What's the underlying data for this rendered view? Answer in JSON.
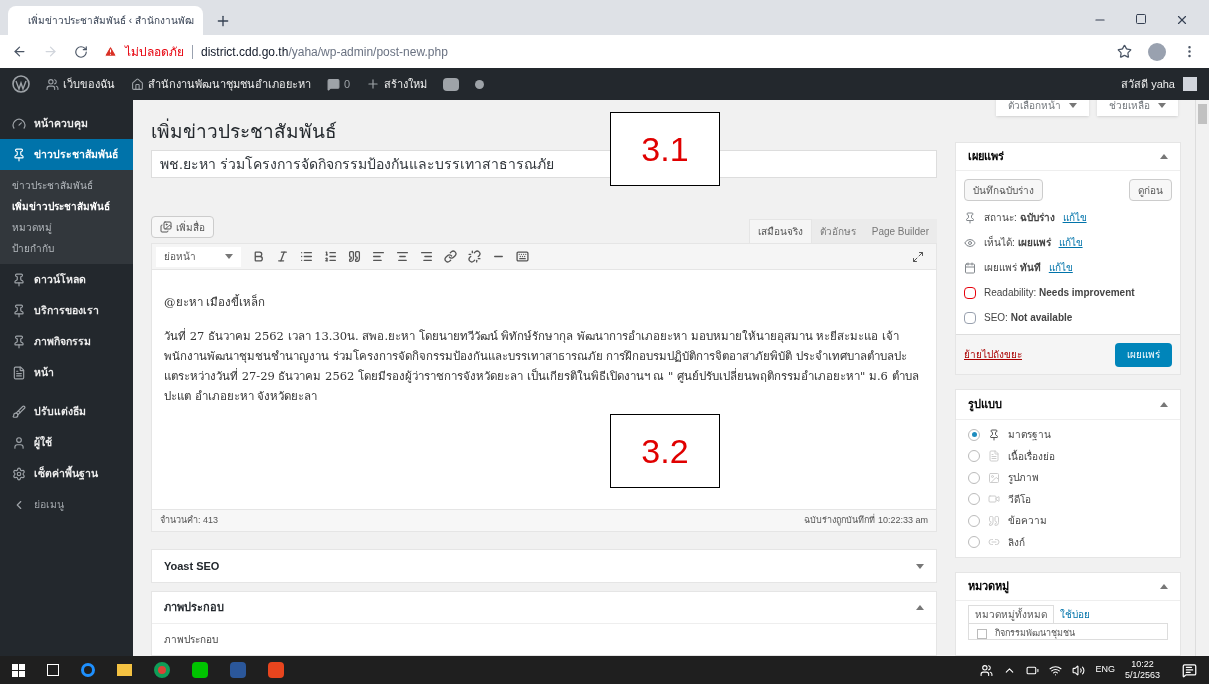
{
  "browser": {
    "tab_title": "เพิ่มข่าวประชาสัมพันธ์ ‹ สำนักงานพัฒ",
    "security": "ไม่ปลอดภัย",
    "url_host": "district.cdd.go.th",
    "url_path": "/yaha/wp-admin/post-new.php"
  },
  "admin_bar": {
    "site": "เว็บของฉัน",
    "office": "สำนักงานพัฒนาชุมชนอำเภอยะหา",
    "comments": "0",
    "new": "สร้างใหม่",
    "greeting": "สวัสดี yaha"
  },
  "sidebar": {
    "items": [
      {
        "label": "หน้าควบคุม",
        "selected": false
      },
      {
        "label": "ข่าวประชาสัมพันธ์",
        "selected": true,
        "submenu": [
          {
            "label": "ข่าวประชาสัมพันธ์",
            "selected": false
          },
          {
            "label": "เพิ่มข่าวประชาสัมพันธ์",
            "selected": true
          },
          {
            "label": "หมวดหมู่",
            "selected": false
          },
          {
            "label": "ป้ายกำกับ",
            "selected": false
          }
        ]
      },
      {
        "label": "ดาวน์โหลด",
        "selected": false
      },
      {
        "label": "บริการของเรา",
        "selected": false
      },
      {
        "label": "ภาพกิจกรรม",
        "selected": false
      },
      {
        "label": "หน้า",
        "selected": false
      },
      {
        "label": "ปรับแต่งธีม",
        "selected": false
      },
      {
        "label": "ผู้ใช้",
        "selected": false
      },
      {
        "label": "เซ็ตค่าพื้นฐาน",
        "selected": false
      },
      {
        "label": "ย่อเมนู",
        "selected": false
      }
    ]
  },
  "screen_buttons": [
    "ตัวเลือกหน้า",
    "ช่วยเหลือ"
  ],
  "page_title": "เพิ่มข่าวประชาสัมพันธ์",
  "post_title": "พช.ยะหา ร่วมโครงการจัดกิจกรรมป้องกันและบรรเทาสาธารณภัย",
  "editor": {
    "add_media": "เพิ่มสื่อ",
    "tabs": [
      {
        "label": "เสมือนจริง",
        "selected": true
      },
      {
        "label": "ตัวอักษร",
        "selected": false
      },
      {
        "label": "Page Builder",
        "selected": false
      }
    ],
    "format": "ย่อหน้า",
    "paragraphs": [
      "@ยะหา เมืองขี้เหล็ก",
      "วันที่ 27 ธันวาคม 2562 เวลา 13.30น. สพอ.ยะหา โดยนายทวีวัฒน์ พิทักษ์รักษากุล พัฒนาการอำเภอยะหา มอบหมายให้นายอุสมาน  หะยีสะมะแอ  เจ้าพนักงานพัฒนาชุมชนชำนาญงาน  ร่วมโครงการจัดกิจกรรมป้องกันและบรรเทาสาธารณภัย การฝึกอบรมปฏิบัติการจิตอาสาภัยพิบัติ ประจำเทศบาลตำบลปะแตระหว่างวันที่  27-29  ธันวาคม 2562  โดยมีรองผู้ว่าราชการจังหวัดยะลา เป็นเกียรติในพิธีเปิดงานฯ ณ \" ศูนย์ปรับเปลี่ยนพฤติกรรมอำเภอยะหา\" ม.6  ตำบลปะแต  อำเภอยะหา จังหวัดยะลา"
    ],
    "word_count": "จำนวนคำ: 413",
    "saved": "ฉบับร่างถูกบันทึกที่ 10:22:33 am"
  },
  "metaboxes": [
    {
      "title": "Yoast SEO",
      "expanded": false
    },
    {
      "title": "ภาพประกอบ",
      "expanded": true,
      "content": "ภาพประกอบ"
    }
  ],
  "publish": {
    "title": "เผยแพร่",
    "save_draft": "บันทึกฉบับร่าง",
    "preview": "ดูก่อน",
    "rows": [
      {
        "text": "สถานะ: **ฉบับร่าง**",
        "link": "แก้ไข"
      },
      {
        "text": "เห็นได้: **เผยแพร่**",
        "link": "แก้ไข"
      },
      {
        "text": "เผยแพร่ **ทันที**",
        "link": "แก้ไข"
      },
      {
        "text": "Readability: **Needs improvement**"
      },
      {
        "text": "SEO: **Not available**"
      }
    ],
    "trash": "ย้ายไปถังขยะ",
    "publish": "เผยแพร่"
  },
  "format_box": {
    "title": "รูปแบบ",
    "options": [
      {
        "label": "มาตรฐาน",
        "selected": true
      },
      {
        "label": "เนื้อเรื่องย่อ",
        "selected": false
      },
      {
        "label": "รูปภาพ",
        "selected": false
      },
      {
        "label": "วีดีโอ",
        "selected": false
      },
      {
        "label": "ข้อความ",
        "selected": false
      },
      {
        "label": "ลิงก์",
        "selected": false
      }
    ]
  },
  "categories": {
    "title": "หมวดหมู่",
    "tabs": [
      {
        "label": "หมวดหมู่ทั้งหมด",
        "selected": true
      },
      {
        "label": "ใช้บ่อย",
        "selected": false
      }
    ],
    "items": [
      {
        "label": "กิจกรรมพัฒนาชุมชน",
        "checked": false
      }
    ]
  },
  "annotations": [
    "3.1",
    "3.2"
  ],
  "taskbar": {
    "language": "ENG",
    "time": "10:22",
    "date": "5/1/2563"
  }
}
